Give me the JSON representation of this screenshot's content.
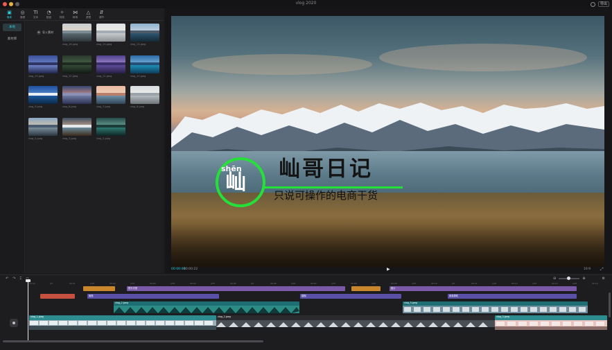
{
  "window": {
    "title": "vlog 2020",
    "export_label": "导出",
    "traffic_colors": [
      "#ee5b55",
      "#e9b33b",
      "#5b5b60"
    ]
  },
  "toolbar": {
    "items": [
      {
        "label": "媒体",
        "glyph": "▣",
        "icon": "media-icon"
      },
      {
        "label": "音频",
        "glyph": "◎",
        "icon": "audio-icon"
      },
      {
        "label": "文本",
        "glyph": "TI",
        "icon": "text-icon"
      },
      {
        "label": "贴纸",
        "glyph": "◔",
        "icon": "sticker-icon"
      },
      {
        "label": "特效",
        "glyph": "✧",
        "icon": "effects-icon"
      },
      {
        "label": "转场",
        "glyph": "⋈",
        "icon": "transition-icon"
      },
      {
        "label": "滤镜",
        "glyph": "△",
        "icon": "filter-icon"
      },
      {
        "label": "调节",
        "glyph": "⇵",
        "icon": "adjust-icon"
      }
    ],
    "accent": "#2bd0d8"
  },
  "categories": {
    "items": [
      "本地",
      "素材库"
    ]
  },
  "media": {
    "import_label": "导入素材",
    "items": [
      {
        "name": "vlog_16.jpeg"
      },
      {
        "name": "vlog_15.jpeg"
      },
      {
        "name": "vlog_14.jpeg"
      },
      {
        "name": "vlog_13.jpeg"
      },
      {
        "name": "vlog_12.jpeg"
      },
      {
        "name": "vlog_11.jpeg"
      },
      {
        "name": "vlog_10.jpeg"
      },
      {
        "name": "vlog_9.jpeg"
      },
      {
        "name": "vlog_8.jpeg"
      },
      {
        "name": "vlog_7.jpeg"
      },
      {
        "name": "vlog_6.jpeg"
      },
      {
        "name": "vlog_5.jpeg"
      },
      {
        "name": "vlog_3.jpeg"
      },
      {
        "name": "vlog_2.jpeg"
      }
    ]
  },
  "preview": {
    "watermark": {
      "pinyin": "shēn",
      "glyph": "屾",
      "title": "屾哥日记",
      "subtitle": "只说可操作的电商干货",
      "color": "#26e03a"
    },
    "current_time": "00:00:00",
    "total_time": "00:00:22",
    "ratio": "16:9",
    "play_glyph": "▶",
    "fullscreen_glyph": "⤢"
  },
  "timeline": {
    "tool_glyphs": [
      "↶",
      "↷",
      "⌶",
      "◻"
    ],
    "ruler_ticks": [
      "00:00",
      "|5f",
      "00:01",
      "|10f",
      "00:02",
      "|15f",
      "00:03",
      "|20f",
      "00:04",
      "|25f",
      "00:05",
      "|5f",
      "00:06",
      "|10f",
      "00:07",
      "|15f",
      "00:08",
      "|20f",
      "00:09",
      "|25f",
      "00:10",
      "|5f",
      "00:11",
      "|10f",
      "00:12",
      "|15f",
      "00:13",
      "|20f",
      "00:14",
      "|25f",
      "00:15"
    ],
    "clip_labels": {
      "orange_top": "",
      "purple_long_1": "镜头光晕",
      "orange_mid": "",
      "purple_long_2": "胶片",
      "red_text": "",
      "purple_row2_1": "暗角",
      "purple_row2_2": "模糊",
      "purple_row2_3": "胶卷颗粒",
      "film_teal_1": "vlog_2.jpeg",
      "film_teal_2": "vlog_5.jpeg",
      "film_main_1": "vlog_1.jpeg",
      "film_main_2": "vlog_2.jpeg",
      "film_main_3": "vlog_3.jpeg"
    }
  }
}
